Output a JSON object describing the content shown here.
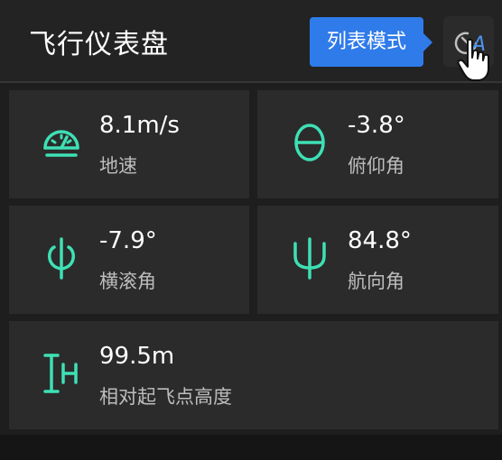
{
  "header": {
    "title": "飞行仪表盘",
    "tooltip": "列表模式",
    "mode_button_icon": "speed-A-icon"
  },
  "accent_color": "#3ee0b5",
  "cards": [
    {
      "value": "8.1m/s",
      "label": "地速",
      "icon": "speedometer-icon"
    },
    {
      "value": "-3.8°",
      "label": "俯仰角",
      "icon": "theta-icon"
    },
    {
      "value": "-7.9°",
      "label": "横滚角",
      "icon": "phi-icon"
    },
    {
      "value": "84.8°",
      "label": "航向角",
      "icon": "psi-icon"
    },
    {
      "value": "99.5m",
      "label": "相对起飞点高度",
      "icon": "height-icon"
    }
  ]
}
